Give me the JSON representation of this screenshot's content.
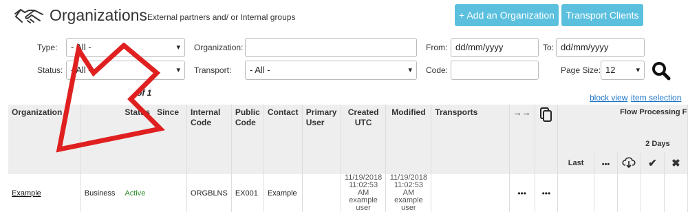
{
  "header": {
    "title": "Organizations",
    "subtitle": "External partners and/ or Internal groups",
    "add_button": "+ Add an Organization",
    "transport_button": "Transport Clients",
    "icon": "handshake-icon"
  },
  "filters": {
    "type_label": "Type:",
    "type_value": "- All -",
    "status_label": "Status:",
    "status_value": "- All -",
    "organization_label": "Organization:",
    "organization_value": "",
    "transport_label": "Transport:",
    "transport_value": "- All -",
    "from_label": "From:",
    "from_placeholder": "dd/mm/yyyy",
    "to_label": "To:",
    "to_placeholder": "dd/mm/yyyy",
    "code_label": "Code:",
    "code_value": "",
    "page_size_label": "Page Size:",
    "page_size_value": "12",
    "search_icon": "search-icon"
  },
  "pager_text": "of 1",
  "view_links": {
    "block": "block view",
    "item": "item selection"
  },
  "table": {
    "headers": {
      "organization": "Organization",
      "status": "Status",
      "since": "Since",
      "internal_code": "Internal Code",
      "public_code": "Public Code",
      "contact": "Contact",
      "primary_user": "Primary User",
      "created": "Created UTC",
      "modified": "Modified",
      "transports": "Transports",
      "flow_processing": "Flow Processing F",
      "two_days": "2 Days",
      "last": "Last"
    },
    "rows": [
      {
        "organization": "Example",
        "type": "Business",
        "status": "Active",
        "internal_code": "ORGBLNS",
        "public_code": "EX001",
        "contact": "Example",
        "created_date": "11/19/2018",
        "created_time": "11:02:53 AM",
        "created_user": "example user",
        "modified_date": "11/19/2018",
        "modified_time": "11:02:53 AM",
        "modified_user": "example user",
        "actions1": "•••",
        "actions2": "•••"
      }
    ]
  },
  "colors": {
    "accent": "#5bc0de",
    "active": "#2e8b2e",
    "arrow": "#e02020"
  }
}
